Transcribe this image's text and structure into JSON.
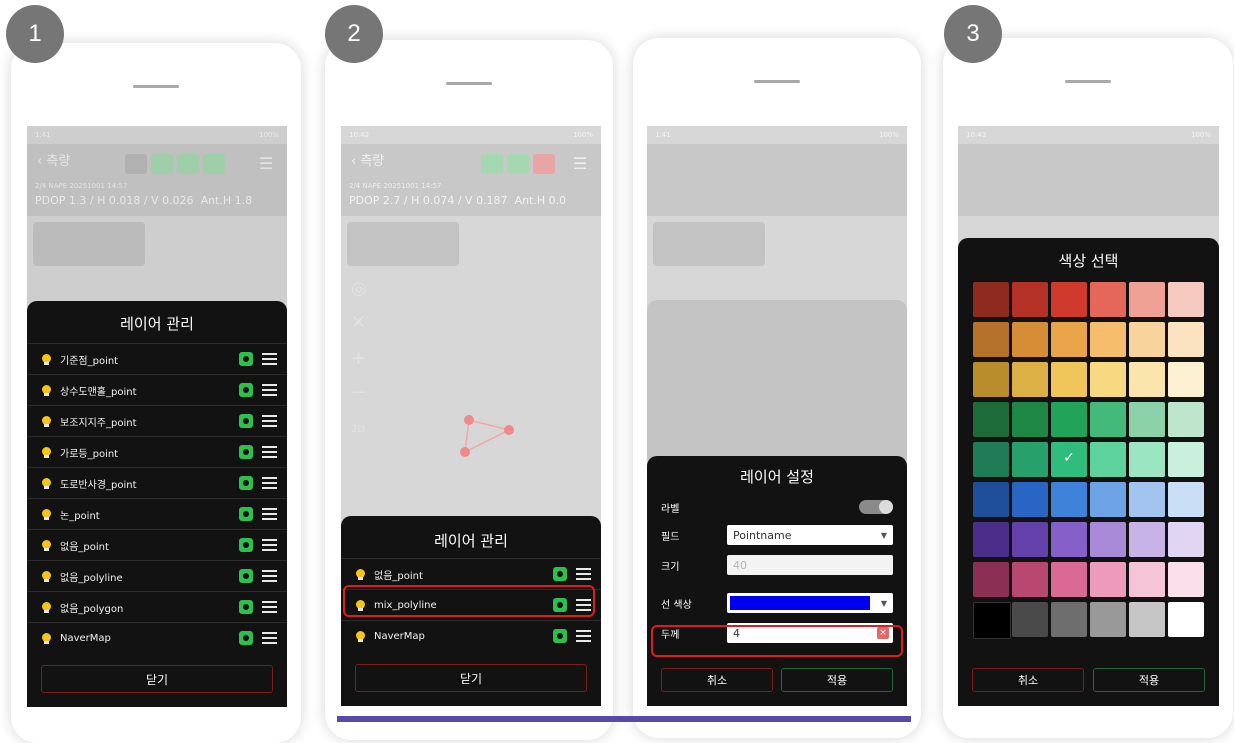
{
  "steps": [
    "1",
    "2",
    "3"
  ],
  "status": {
    "time_1": "1:41",
    "time_2": "10:42",
    "time_3": "1:41",
    "time_4": "10:43",
    "battery": "100%"
  },
  "appbar": {
    "title": "측량",
    "info": "2/4 NAPE 20251001 14:57",
    "dop_1": "PDOP 1.3 / H 0.018 / V 0.026",
    "ant_1": "Ant.H 1.8",
    "dop_2": "PDOP 2.7 / H 0.074 / V 0.187",
    "ant_2": "Ant.H 0.0"
  },
  "layer_manager": {
    "title": "레이어 관리",
    "close": "닫기",
    "layers": [
      "기준점_point",
      "상수도맨홀_point",
      "보조지지주_point",
      "가로등_point",
      "도로반사경_point",
      "논_point",
      "없음_point",
      "없음_polyline",
      "없음_polygon",
      "NaverMap"
    ],
    "layers_2": [
      "없음_point",
      "mix_polyline",
      "NaverMap"
    ]
  },
  "map_tools": {
    "mode": "2D"
  },
  "layer_settings": {
    "title": "레이어 설정",
    "label": "라벨",
    "field_label": "필드",
    "field_value": "Pointname",
    "size_label": "크기",
    "size_value": "40",
    "line_color_label": "선 색상",
    "line_color": "#0000ee",
    "thickness_label": "두께",
    "thickness_value": "4",
    "cancel": "취소",
    "apply": "적용"
  },
  "color_picker": {
    "title": "색상 선택",
    "cancel": "취소",
    "apply": "적용",
    "selected_index": 26,
    "colors": [
      "#8f2a1f",
      "#b43225",
      "#d03a2c",
      "#e5675a",
      "#f0a196",
      "#f5c8c0",
      "#b5722a",
      "#d58e35",
      "#eaa449",
      "#f5bd6c",
      "#f8d39b",
      "#fbe3c2",
      "#b98d2c",
      "#dcb045",
      "#f0c65a",
      "#f7d982",
      "#fae6ac",
      "#fcf1d1",
      "#1e6b3a",
      "#1f8745",
      "#22a35a",
      "#43b97a",
      "#8bd2a8",
      "#bde6cd",
      "#1f7c56",
      "#27a06c",
      "#2fbc7c",
      "#5ed39c",
      "#9be5c2",
      "#c8f0dd",
      "#1f4f9a",
      "#2966c4",
      "#3f82d9",
      "#6ea3e5",
      "#a3c4ef",
      "#cadef6",
      "#4a2e8a",
      "#6440aa",
      "#8460c8",
      "#a98ad9",
      "#c8b3e7",
      "#e1d6f2",
      "#8c2f54",
      "#b8486f",
      "#d86a93",
      "#ec9bba",
      "#f5c4d6",
      "#fae0ea",
      "#000000",
      "#4a4a4a",
      "#6e6e6e",
      "#999999",
      "#c6c6c6",
      "#ffffff"
    ]
  }
}
